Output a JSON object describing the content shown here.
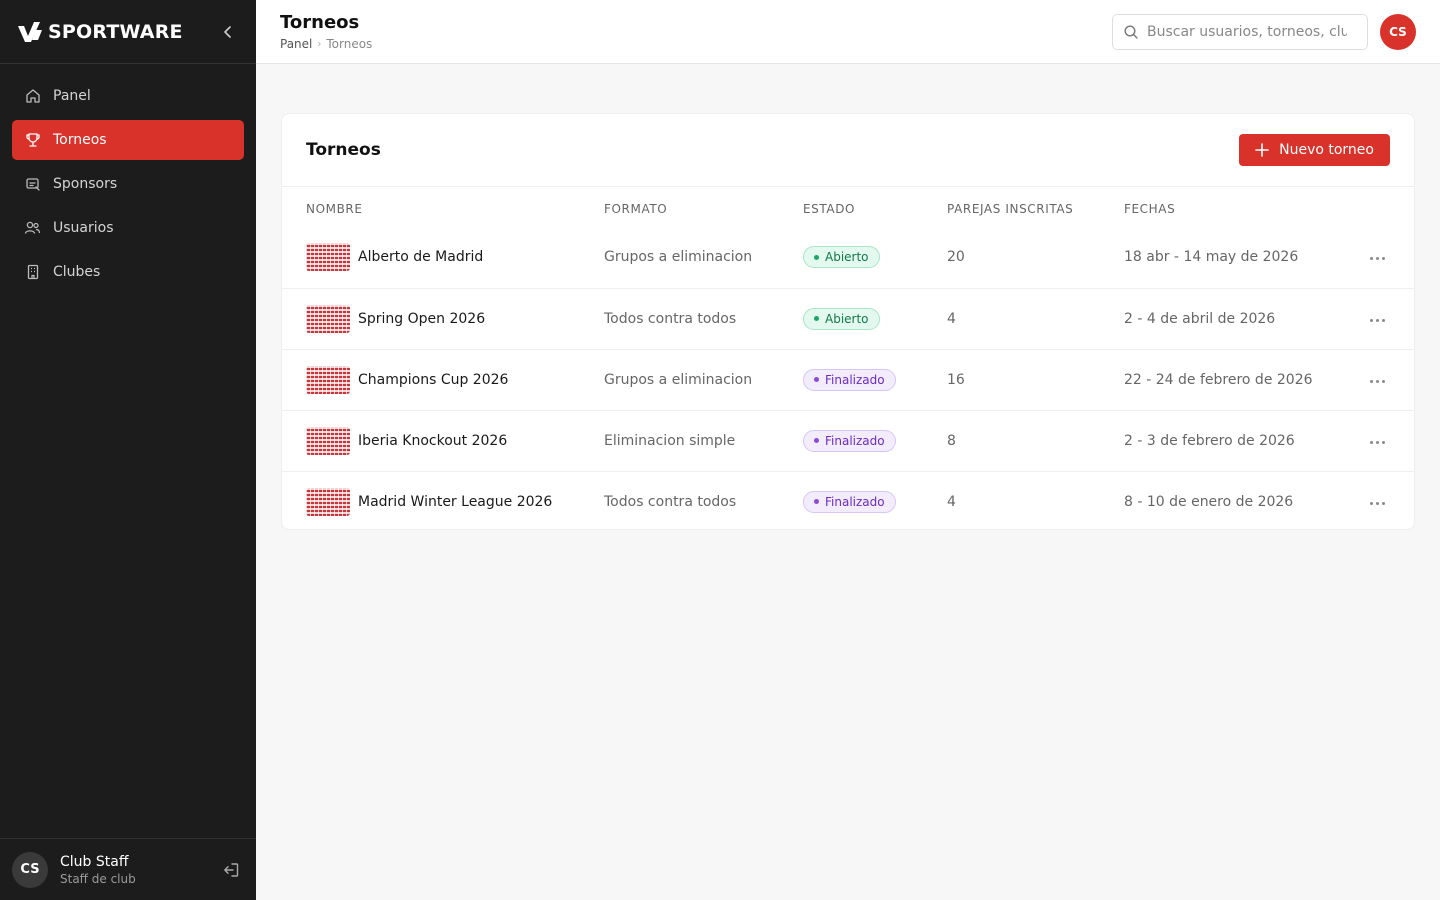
{
  "brand": {
    "name": "SPORTWARE"
  },
  "sidebar": {
    "items": [
      {
        "label": "Panel",
        "icon": "home-icon",
        "active": false
      },
      {
        "label": "Torneos",
        "icon": "trophy-icon",
        "active": true
      },
      {
        "label": "Sponsors",
        "icon": "sponsor-icon",
        "active": false
      },
      {
        "label": "Usuarios",
        "icon": "users-icon",
        "active": false
      },
      {
        "label": "Clubes",
        "icon": "building-icon",
        "active": false
      }
    ],
    "user": {
      "initials": "CS",
      "name": "Club Staff",
      "role": "Staff de club"
    }
  },
  "header": {
    "title": "Torneos",
    "breadcrumb": {
      "root": "Panel",
      "current": "Torneos"
    },
    "search_placeholder": "Buscar usuarios, torneos, clubes...",
    "avatar_initials": "CS"
  },
  "card": {
    "title": "Torneos",
    "new_button_label": "Nuevo torneo",
    "columns": [
      "NOMBRE",
      "FORMATO",
      "ESTADO",
      "PAREJAS INSCRITAS",
      "FECHAS"
    ],
    "rows": [
      {
        "name": "Alberto de Madrid",
        "format": "Grupos a eliminacion",
        "status": "Abierto",
        "pairs": "20",
        "dates": "18 abr - 14 may de 2026"
      },
      {
        "name": "Spring Open 2026",
        "format": "Todos contra todos",
        "status": "Abierto",
        "pairs": "4",
        "dates": "2 - 4 de abril de 2026"
      },
      {
        "name": "Champions Cup 2026",
        "format": "Grupos a eliminacion",
        "status": "Finalizado",
        "pairs": "16",
        "dates": "22 - 24 de febrero de 2026"
      },
      {
        "name": "Iberia Knockout 2026",
        "format": "Eliminacion simple",
        "status": "Finalizado",
        "pairs": "8",
        "dates": "2 - 3 de febrero de 2026"
      },
      {
        "name": "Madrid Winter League 2026",
        "format": "Todos contra todos",
        "status": "Finalizado",
        "pairs": "4",
        "dates": "8 - 10 de enero de 2026"
      }
    ]
  },
  "colors": {
    "accent": "#d8322a",
    "sidebar_bg": "#1c1c1c",
    "open_badge": "#19a866",
    "done_badge": "#8a4bd8"
  }
}
